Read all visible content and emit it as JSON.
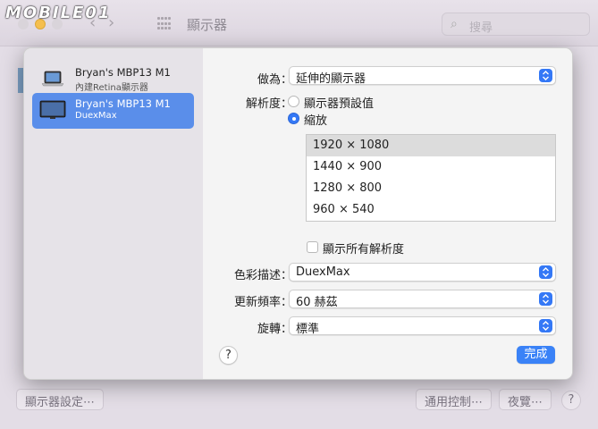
{
  "watermark": "MOBILE01",
  "window": {
    "title": "顯示器",
    "search_placeholder": "搜尋"
  },
  "bottom_bar": {
    "display_settings": "顯示器設定⋯",
    "universal_control": "通用控制⋯",
    "night_shift": "夜覽⋯",
    "help": "?"
  },
  "sidebar": {
    "displays": [
      {
        "name": "Bryan's MBP13 M1",
        "subtitle": "內建Retina顯示器",
        "icon": "laptop-icon",
        "selected": false
      },
      {
        "name": "Bryan's MBP13 M1",
        "subtitle": "DuexMax",
        "icon": "monitor-icon",
        "selected": true
      }
    ]
  },
  "settings": {
    "use_as": {
      "label": "做為：",
      "value": "延伸的顯示器"
    },
    "resolution": {
      "label": "解析度：",
      "options": [
        {
          "label": "顯示器預設值",
          "selected": false
        },
        {
          "label": "縮放",
          "selected": true
        }
      ],
      "list": [
        "1920 × 1080",
        "1440 × 900",
        "1280 × 800",
        "960 × 540"
      ],
      "selected_index": 0,
      "show_all_label": "顯示所有解析度",
      "show_all_checked": false
    },
    "color_profile": {
      "label": "色彩描述：",
      "value": "DuexMax"
    },
    "refresh_rate": {
      "label": "更新頻率：",
      "value": "60 赫茲"
    },
    "rotation": {
      "label": "旋轉：",
      "value": "標準"
    }
  },
  "sheet_buttons": {
    "help": "?",
    "done": "完成"
  },
  "colors": {
    "accent": "#3478f6",
    "selected_row": "#5a8eea"
  }
}
